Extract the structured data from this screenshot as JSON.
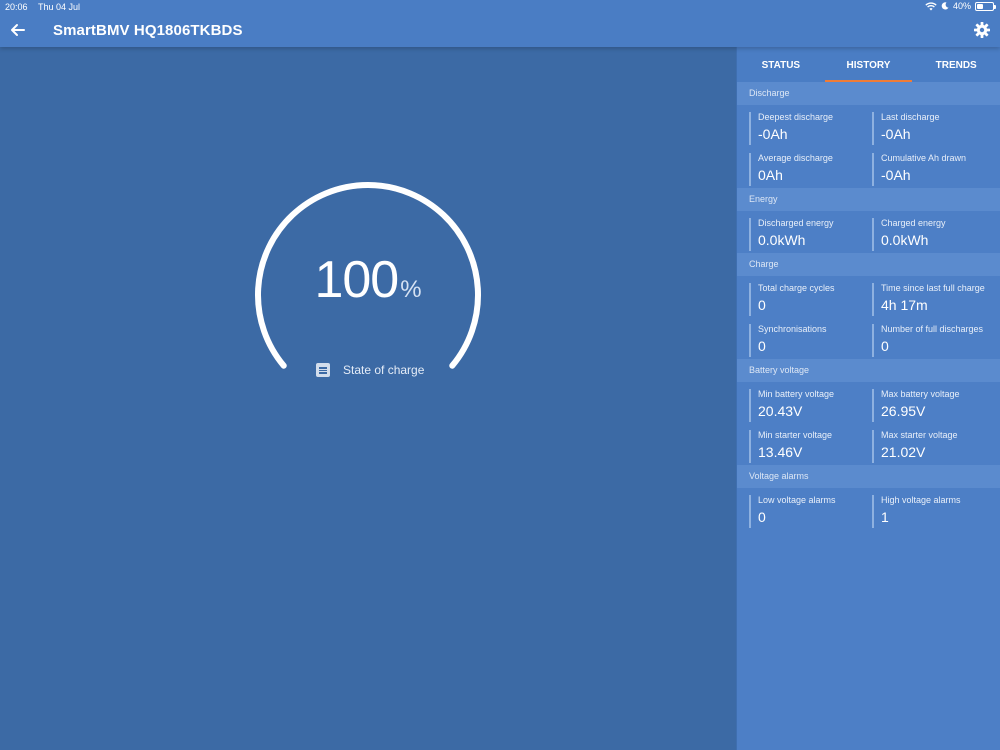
{
  "status_bar": {
    "time": "20:06",
    "date": "Thu 04 Jul",
    "battery_percent": "40%",
    "battery_level": 0.4
  },
  "app_bar": {
    "title": "SmartBMV HQ1806TKBDS",
    "back_icon": "arrow-left-icon",
    "settings_icon": "gear-icon"
  },
  "gauge": {
    "value": "100",
    "unit": "%",
    "fraction": 1.0,
    "caption": "State of charge",
    "caption_icon": "list-document-icon"
  },
  "tabs": [
    {
      "label": "STATUS",
      "active": false
    },
    {
      "label": "HISTORY",
      "active": true
    },
    {
      "label": "TRENDS",
      "active": false
    }
  ],
  "sections": [
    {
      "title": "Discharge",
      "stats": [
        {
          "label": "Deepest discharge",
          "value": "-0Ah"
        },
        {
          "label": "Last discharge",
          "value": "-0Ah"
        },
        {
          "label": "Average discharge",
          "value": "0Ah"
        },
        {
          "label": "Cumulative Ah drawn",
          "value": "-0Ah"
        }
      ]
    },
    {
      "title": "Energy",
      "stats": [
        {
          "label": "Discharged energy",
          "value": "0.0kWh"
        },
        {
          "label": "Charged energy",
          "value": "0.0kWh"
        }
      ]
    },
    {
      "title": "Charge",
      "stats": [
        {
          "label": "Total charge cycles",
          "value": "0"
        },
        {
          "label": "Time since last full charge",
          "value": "4h 17m"
        },
        {
          "label": "Synchronisations",
          "value": "0"
        },
        {
          "label": "Number of full discharges",
          "value": "0"
        }
      ]
    },
    {
      "title": "Battery voltage",
      "stats": [
        {
          "label": "Min battery voltage",
          "value": "20.43V"
        },
        {
          "label": "Max battery voltage",
          "value": "26.95V"
        },
        {
          "label": "Min starter voltage",
          "value": "13.46V"
        },
        {
          "label": "Max starter voltage",
          "value": "21.02V"
        }
      ]
    },
    {
      "title": "Voltage alarms",
      "stats": [
        {
          "label": "Low voltage alarms",
          "value": "0"
        },
        {
          "label": "High voltage alarms",
          "value": "1"
        }
      ]
    }
  ],
  "colors": {
    "background": "#3c6aa5",
    "app_bar": "#4a7dc4",
    "panel": "#4d7fc6",
    "tab_indicator": "#f07c36"
  }
}
